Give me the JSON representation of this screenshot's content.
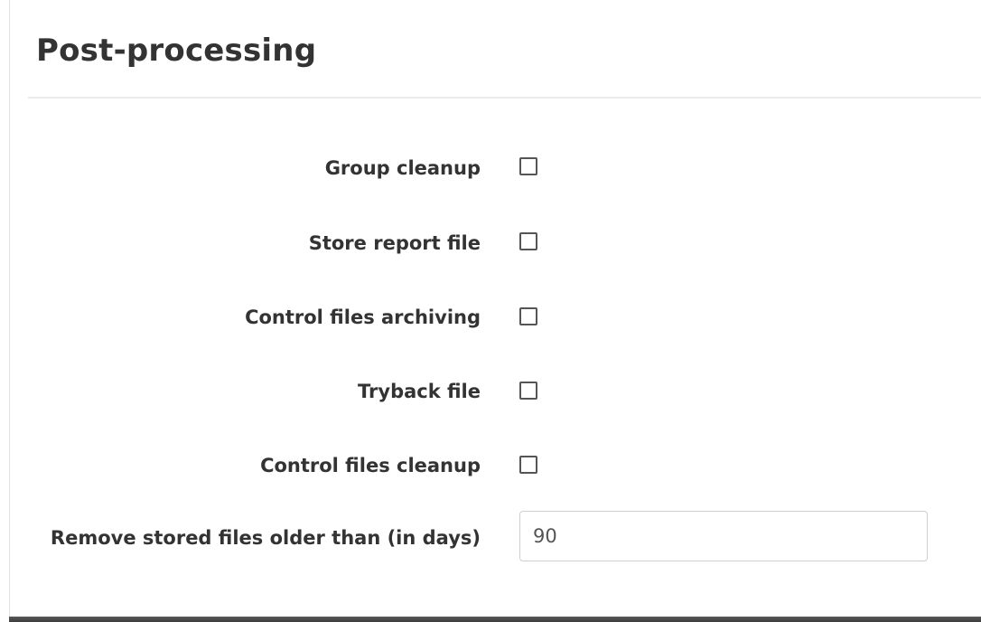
{
  "section": {
    "title": "Post-processing"
  },
  "fields": [
    {
      "label": "Group cleanup",
      "checked": false
    },
    {
      "label": "Store report file",
      "checked": false
    },
    {
      "label": "Control files archiving",
      "checked": false
    },
    {
      "label": "Tryback file",
      "checked": false
    },
    {
      "label": "Control files cleanup",
      "checked": false
    }
  ],
  "retention": {
    "label": "Remove stored files older than (in days)",
    "value": "90"
  }
}
